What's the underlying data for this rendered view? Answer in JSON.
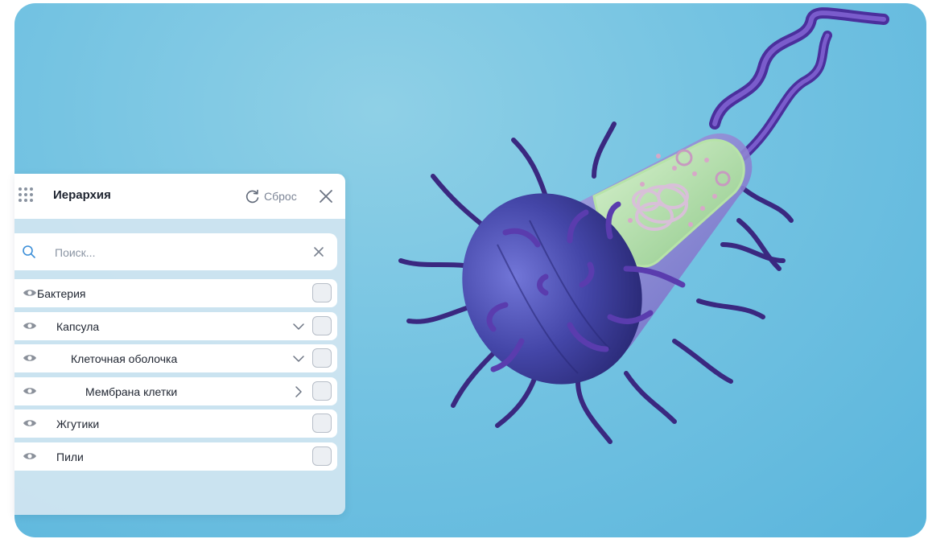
{
  "panel": {
    "title": "Иерархия",
    "reset_label": "Сброс",
    "search_placeholder": "Поиск..."
  },
  "tree": {
    "items": [
      {
        "label": "Бактерия",
        "level": 0,
        "expander": "none",
        "checked": false
      },
      {
        "label": "Капсула",
        "level": 1,
        "expander": "expanded",
        "checked": false
      },
      {
        "label": "Клеточная оболочка",
        "level": 2,
        "expander": "expanded",
        "checked": false
      },
      {
        "label": "Мембрана клетки",
        "level": 3,
        "expander": "collapsed",
        "checked": false
      },
      {
        "label": "Жгутики",
        "level": 1,
        "expander": "none",
        "checked": false
      },
      {
        "label": "Пили",
        "level": 1,
        "expander": "none",
        "checked": false
      }
    ]
  },
  "colors": {
    "viewport_background": "#6fc0e1",
    "bacterium_body": "#3c3d9a",
    "bacterium_inner": "#9fd48e",
    "flagella": "#5b3aa8",
    "panel_background": "#cfe4f0"
  },
  "icons": {
    "grip": "grip-dots-icon",
    "reset": "refresh-icon",
    "close": "close-icon",
    "search": "search-icon",
    "visibility": "eye-icon"
  }
}
